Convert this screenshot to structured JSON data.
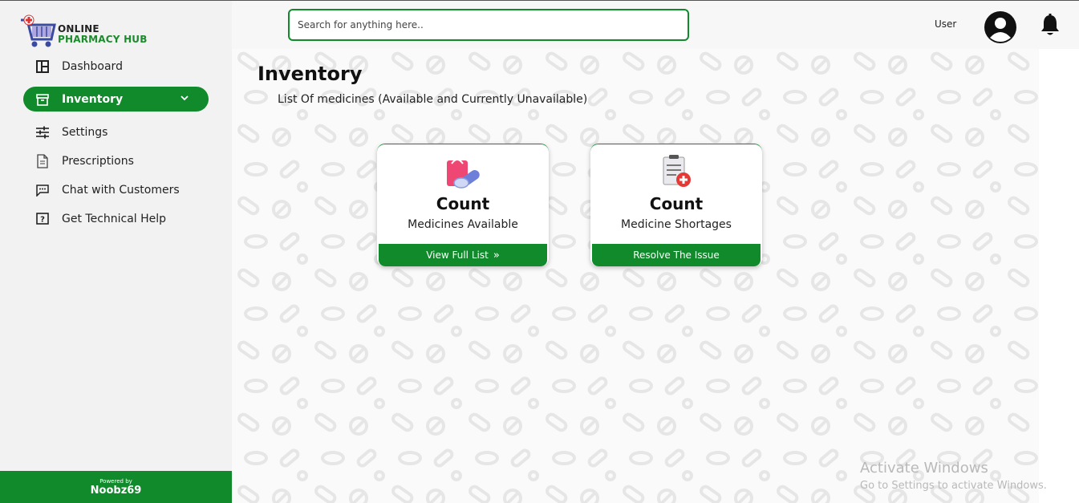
{
  "app": {
    "logo_line1": "ONLINE",
    "logo_line2": "PHARMACY HUB"
  },
  "sidebar": {
    "items": [
      {
        "label": "Dashboard",
        "icon": "dashboard-icon",
        "active": false
      },
      {
        "label": "Inventory",
        "icon": "inventory-icon",
        "active": true
      },
      {
        "label": "Settings",
        "icon": "sliders-icon",
        "active": false
      },
      {
        "label": "Prescriptions",
        "icon": "document-icon",
        "active": false
      },
      {
        "label": "Chat with Customers",
        "icon": "chat-icon",
        "active": false
      },
      {
        "label": "Get Technical Help",
        "icon": "help-icon",
        "active": false
      }
    ],
    "footer_small": "Powered by",
    "footer_big": "Noobz69"
  },
  "header": {
    "search_placeholder": "Search for anything here..",
    "user_label": "User"
  },
  "main": {
    "title": "Inventory",
    "subtitle": "List Of medicines (Available and Currently Unavailable)",
    "cards": [
      {
        "count": "Count",
        "label": "Medicines Available",
        "action": "View Full List",
        "icon": "medicine-bag-icon"
      },
      {
        "count": "Count",
        "label": "Medicine Shortages",
        "action": "Resolve The Issue",
        "icon": "medical-report-icon"
      }
    ]
  },
  "watermark": {
    "line1": "Activate Windows",
    "line2": "Go to Settings to activate Windows."
  },
  "colors": {
    "brand_green": "#118a2c",
    "sidebar_bg": "#f2f2f2"
  }
}
